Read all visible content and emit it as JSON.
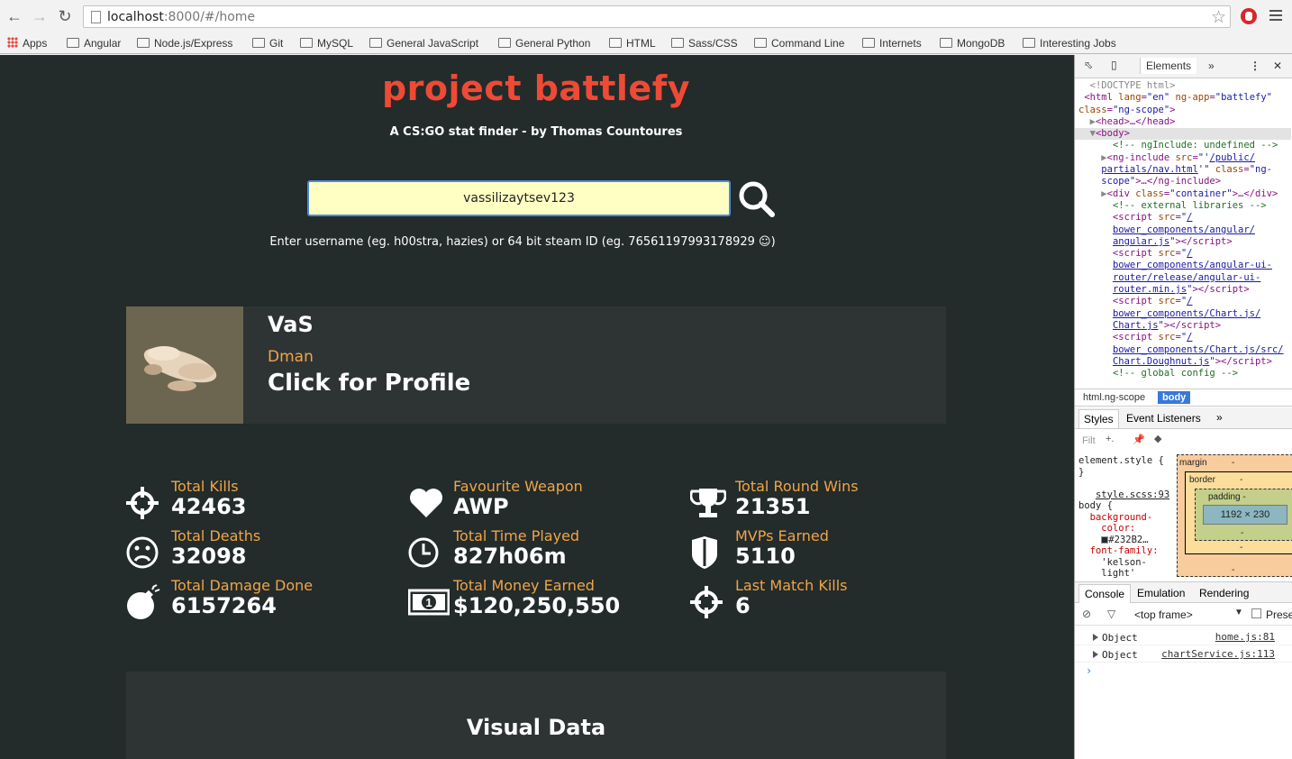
{
  "browser": {
    "url_host": "localhost",
    "url_path": ":8000/#/home",
    "bookmarks": [
      "Apps",
      "Angular",
      "Node.js/Express",
      "Git",
      "MySQL",
      "General JavaScript",
      "General Python",
      "HTML",
      "Sass/CSS",
      "Command Line",
      "Internets",
      "MongoDB",
      "Interesting Jobs"
    ]
  },
  "page": {
    "title": "project battlefy",
    "subtitle": "A CS:GO stat finder - by Thomas Countoures",
    "search_value": "vassilizaytsev123",
    "hint": "Enter username (eg. h00stra, hazies) or 64 bit steam ID (eg. 76561197993178929 ☺)",
    "profile": {
      "name": "VaS",
      "rank": "Dman",
      "link": "Click for Profile"
    },
    "stats": [
      {
        "label": "Total Kills",
        "value": "42463",
        "icon": "crosshair-icon"
      },
      {
        "label": "Favourite Weapon",
        "value": "AWP",
        "icon": "heart-icon"
      },
      {
        "label": "Total Round Wins",
        "value": "21351",
        "icon": "trophy-icon"
      },
      {
        "label": "Total Deaths",
        "value": "32098",
        "icon": "sad-face-icon"
      },
      {
        "label": "Total Time Played",
        "value": "827h06m",
        "icon": "clock-icon"
      },
      {
        "label": "MVPs Earned",
        "value": "5110",
        "icon": "shield-icon"
      },
      {
        "label": "Total Damage Done",
        "value": "6157264",
        "icon": "bomb-icon"
      },
      {
        "label": "Total Money Earned",
        "value": "$120,250,550",
        "icon": "money-icon"
      },
      {
        "label": "Last Match Kills",
        "value": "6",
        "icon": "target-icon"
      }
    ],
    "visual_title": "Visual Data"
  },
  "devtools": {
    "tabs": [
      "Elements",
      "»"
    ],
    "breadcrumbs": [
      "html.ng-scope",
      "body"
    ],
    "styles_tabs": [
      "Styles",
      "Event Listeners",
      "»"
    ],
    "filter_placeholder": "Filt",
    "box_model": {
      "margin": "margin",
      "border": "border",
      "padding": "padding -",
      "content": "1192 × 230",
      "dash": "-"
    },
    "console_tabs": [
      "Console",
      "Emulation",
      "Rendering"
    ],
    "frame": "<top frame>",
    "preserve": "Prese",
    "logs": [
      {
        "text": "Object",
        "src": "home.js:81"
      },
      {
        "text": "Object",
        "src": "chartService.js:113"
      }
    ],
    "styles_source": "style.scss:93",
    "element_style": "element.style {",
    "colors": {
      "page_bg": "#232b2b",
      "title": "#ee4a35",
      "accent": "#f0a546",
      "card": "#2e3434",
      "selected": "#3879d9"
    }
  }
}
